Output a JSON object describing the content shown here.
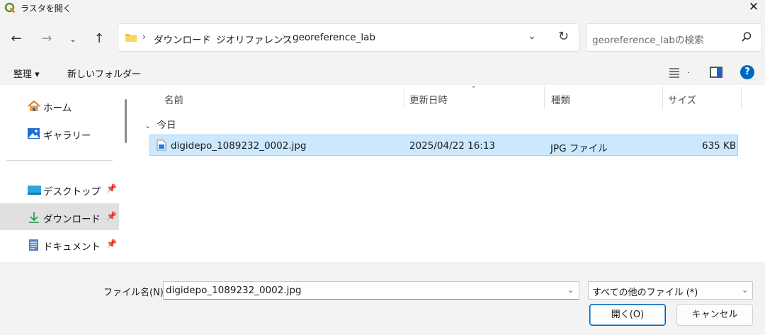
{
  "window": {
    "title": "ラスタを開く",
    "app_icon": "qgis-icon",
    "close_icon": "close-icon"
  },
  "nav": {
    "back_icon": "back-arrow-icon",
    "forward_icon": "forward-arrow-icon",
    "recent_icon": "chevron-down-icon",
    "up_icon": "up-arrow-icon",
    "breadcrumb": [
      "ダウンロード",
      "ジオリファレンス",
      "georeference_lab"
    ],
    "refresh_icon": "refresh-icon",
    "search_placeholder": "georeference_labの検索"
  },
  "commands": {
    "organize": "整理",
    "new_folder": "新しいフォルダー",
    "help": "?"
  },
  "sidebar": {
    "items": [
      {
        "label": "ホーム",
        "icon": "home-icon",
        "pinned": false,
        "selected": false
      },
      {
        "label": "ギャラリー",
        "icon": "gallery-icon",
        "pinned": false,
        "selected": false
      },
      {
        "label": "デスクトップ",
        "icon": "desktop-icon",
        "pinned": true,
        "selected": false
      },
      {
        "label": "ダウンロード",
        "icon": "download-icon",
        "pinned": true,
        "selected": true
      },
      {
        "label": "ドキュメント",
        "icon": "document-icon",
        "pinned": true,
        "selected": false
      }
    ]
  },
  "columns": {
    "name": "名前",
    "modified": "更新日時",
    "type": "種類",
    "size": "サイズ"
  },
  "groups": [
    {
      "label": "今日",
      "files": [
        {
          "name": "digidepo_1089232_0002.jpg",
          "modified": "2025/04/22 16:13",
          "type": "JPG ファイル",
          "size": "635 KB",
          "selected": true
        }
      ]
    }
  ],
  "footer": {
    "filename_label": "ファイル名(N):",
    "filename_value": "digidepo_1089232_0002.jpg",
    "filter_value": "すべての他のファイル (*)",
    "open_button": "開く(O)",
    "cancel_button": "キャンセル"
  },
  "colors": {
    "selection_bg": "#cce8ff",
    "selection_border": "#99d1ff",
    "accent": "#005fb8",
    "help": "#0067c0"
  }
}
